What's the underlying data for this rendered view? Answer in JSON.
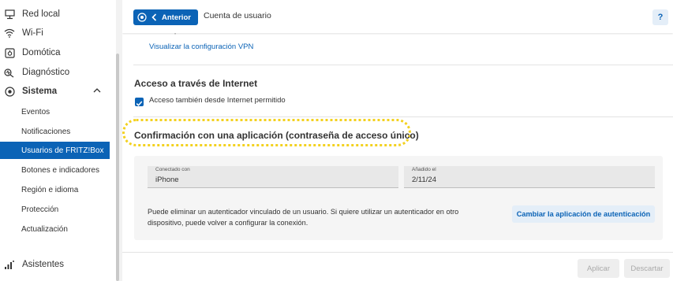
{
  "sidebar": {
    "items": [
      {
        "label": "Red local",
        "icon": "network-icon"
      },
      {
        "label": "Wi-Fi",
        "icon": "wifi-icon"
      },
      {
        "label": "Domótica",
        "icon": "smarthome-icon"
      },
      {
        "label": "Diagnóstico",
        "icon": "diagnostics-icon"
      },
      {
        "label": "Sistema",
        "icon": "system-icon"
      }
    ],
    "subitems": [
      {
        "label": "Eventos"
      },
      {
        "label": "Notificaciones"
      },
      {
        "label": "Usuarios de FRITZ!Box"
      },
      {
        "label": "Botones e indicadores"
      },
      {
        "label": "Región e idioma"
      },
      {
        "label": "Protección"
      },
      {
        "label": "Actualización"
      }
    ],
    "assistants": {
      "label": "Asistentes",
      "icon": "assistants-icon"
    }
  },
  "header": {
    "back_label": "Anterior",
    "title": "Cuenta de usuario",
    "help_label": "?"
  },
  "vpn": {
    "cut_text": "el usuario puede establecer conexiones VPN con FRITZ!Box.",
    "link_label": "Visualizar la configuración VPN"
  },
  "internet_access": {
    "title": "Acceso a través de Internet",
    "checkbox_label": "Acceso también desde Internet permitido",
    "checked": true
  },
  "app_confirmation": {
    "title": "Confirmación con una aplicación (contraseña de acceso único)",
    "connected_label": "Conectado con",
    "connected_value": "iPhone",
    "added_label": "Añadido el",
    "added_value": "2/11/24",
    "info_text": "Puede eliminar un autenticador vinculado de un usuario. Si quiere utilizar un autenticador en otro dispositivo, puede volver a configurar la conexión.",
    "change_button": "Cambiar la aplicación de autenticación"
  },
  "footer": {
    "apply_label": "Aplicar",
    "discard_label": "Descartar"
  },
  "colors": {
    "accent": "#0b63b6",
    "highlight": "#f3d11f"
  }
}
